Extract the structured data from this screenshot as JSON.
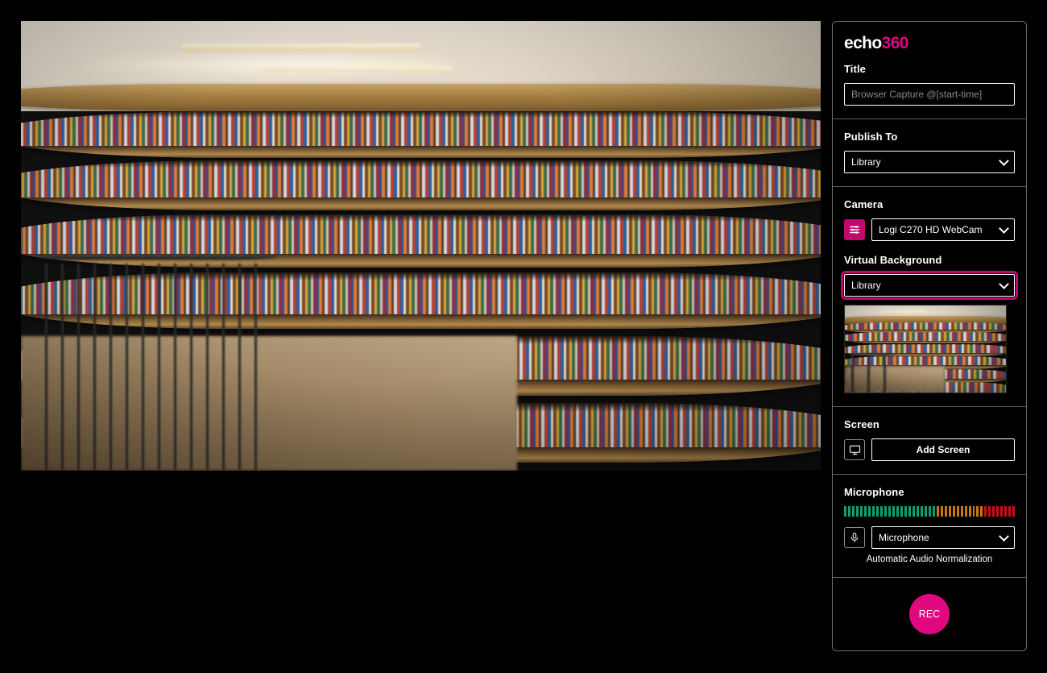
{
  "app": {
    "logo_text": "echo",
    "logo_accent": "360",
    "accent_color": "#c2076e",
    "rec_color": "#e0077f",
    "background": "#000000"
  },
  "preview": {
    "name": "camera-video-preview",
    "description": "Library bookshelves virtual background preview"
  },
  "panel": {
    "title": {
      "label": "Title",
      "value": "",
      "placeholder": "Browser Capture @[start-time]"
    },
    "publish_to": {
      "label": "Publish To",
      "value": "Library",
      "options": [
        "Library"
      ]
    },
    "camera": {
      "label": "Camera",
      "settings_icon": "sliders-icon",
      "value": "Logi C270 HD WebCam",
      "options": [
        "Logi C270 HD WebCam"
      ]
    },
    "virtual_background": {
      "label": "Virtual Background",
      "value": "Library",
      "options": [
        "Library"
      ],
      "focused": true,
      "thumbnail_alt": "Library bookshelves thumbnail"
    },
    "screen": {
      "label": "Screen",
      "icon": "monitor-icon",
      "add_button_label": "Add Screen"
    },
    "microphone": {
      "label": "Microphone",
      "icon": "microphone-icon",
      "value": "Microphone",
      "options": [
        "Microphone"
      ],
      "note": "Automatic Audio Normalization",
      "meter": {
        "green_count": 23,
        "amber_count": 12,
        "red_count": 8,
        "green_color": "#109e72",
        "amber_color": "#c87811",
        "red_color": "#cc0e16"
      }
    },
    "record": {
      "label": "REC"
    }
  }
}
